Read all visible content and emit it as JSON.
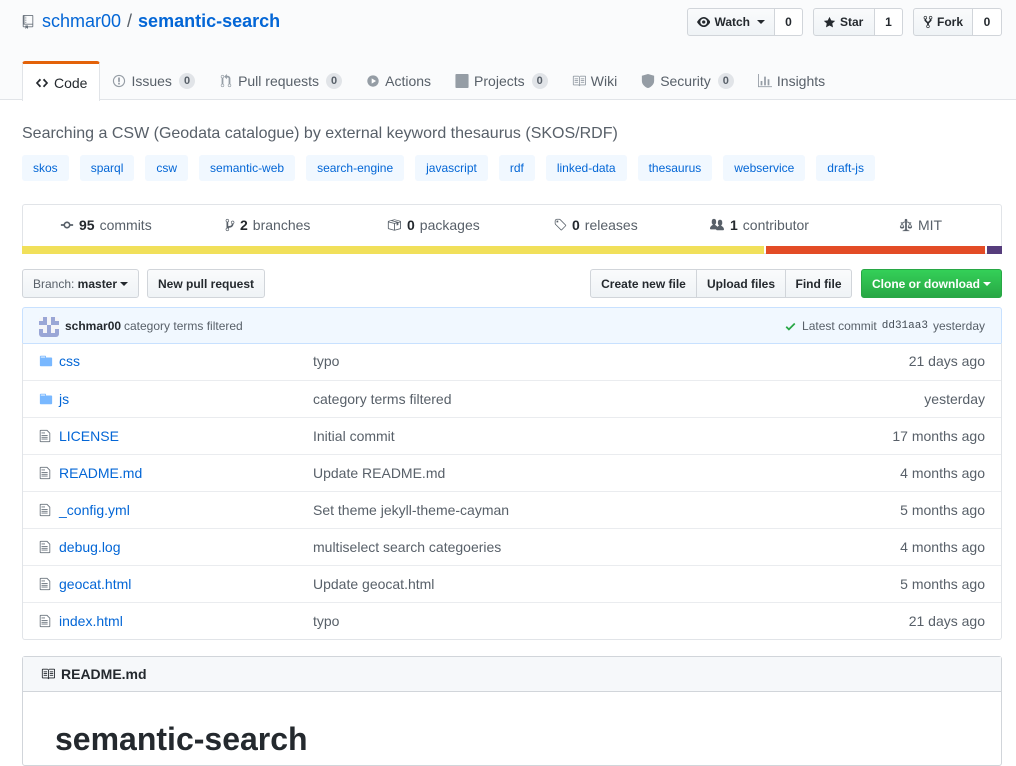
{
  "repo": {
    "owner": "schmar00",
    "separator": "/",
    "name": "semantic-search"
  },
  "actions": {
    "watch": {
      "label": "Watch",
      "count": "0"
    },
    "star": {
      "label": "Star",
      "count": "1"
    },
    "fork": {
      "label": "Fork",
      "count": "0"
    }
  },
  "tabs": [
    {
      "label": "Code",
      "selected": true,
      "icon": "code-icon"
    },
    {
      "label": "Issues",
      "counter": "0",
      "icon": "issue-icon"
    },
    {
      "label": "Pull requests",
      "counter": "0",
      "icon": "pull-request-icon"
    },
    {
      "label": "Actions",
      "icon": "play-icon"
    },
    {
      "label": "Projects",
      "counter": "0",
      "icon": "project-icon"
    },
    {
      "label": "Wiki",
      "icon": "book-icon"
    },
    {
      "label": "Security",
      "counter": "0",
      "icon": "shield-icon"
    },
    {
      "label": "Insights",
      "icon": "graph-icon"
    }
  ],
  "description": "Searching a CSW (Geodata catalogue) by external keyword thesaurus (SKOS/RDF)",
  "topics": [
    "skos",
    "sparql",
    "csw",
    "semantic-web",
    "search-engine",
    "javascript",
    "rdf",
    "linked-data",
    "thesaurus",
    "webservice",
    "draft-js"
  ],
  "numbers": {
    "commits": {
      "count": "95",
      "label": "commits"
    },
    "branches": {
      "count": "2",
      "label": "branches"
    },
    "packages": {
      "count": "0",
      "label": "packages"
    },
    "releases": {
      "count": "0",
      "label": "releases"
    },
    "contributors": {
      "count": "1",
      "label": "contributor"
    },
    "license": "MIT"
  },
  "languages": [
    {
      "color": "#f1e05a",
      "fraction": 0.76
    },
    {
      "color": "#e34c26",
      "fraction": 0.225
    },
    {
      "color": "#563d7c",
      "fraction": 0.015
    }
  ],
  "file_nav": {
    "branch_prefix": "Branch:",
    "branch": "master",
    "new_pr": "New pull request",
    "create_file": "Create new file",
    "upload": "Upload files",
    "find": "Find file",
    "clone": "Clone or download"
  },
  "latest_commit": {
    "author": "schmar00",
    "message": "category terms filtered",
    "label": "Latest commit",
    "sha": "dd31aa3",
    "age": "yesterday"
  },
  "files": [
    {
      "type": "dir",
      "name": "css",
      "message": "typo",
      "age": "21 days ago"
    },
    {
      "type": "dir",
      "name": "js",
      "message": "category terms filtered",
      "age": "yesterday"
    },
    {
      "type": "file",
      "name": "LICENSE",
      "message": "Initial commit",
      "age": "17 months ago"
    },
    {
      "type": "file",
      "name": "README.md",
      "message": "Update README.md",
      "age": "4 months ago"
    },
    {
      "type": "file",
      "name": "_config.yml",
      "message": "Set theme jekyll-theme-cayman",
      "age": "5 months ago"
    },
    {
      "type": "file",
      "name": "debug.log",
      "message": "multiselect search categoeries",
      "age": "4 months ago"
    },
    {
      "type": "file",
      "name": "geocat.html",
      "message": "Update geocat.html",
      "age": "5 months ago"
    },
    {
      "type": "file",
      "name": "index.html",
      "message": "typo",
      "age": "21 days ago"
    }
  ],
  "readme": {
    "filename": "README.md",
    "heading": "semantic-search"
  }
}
